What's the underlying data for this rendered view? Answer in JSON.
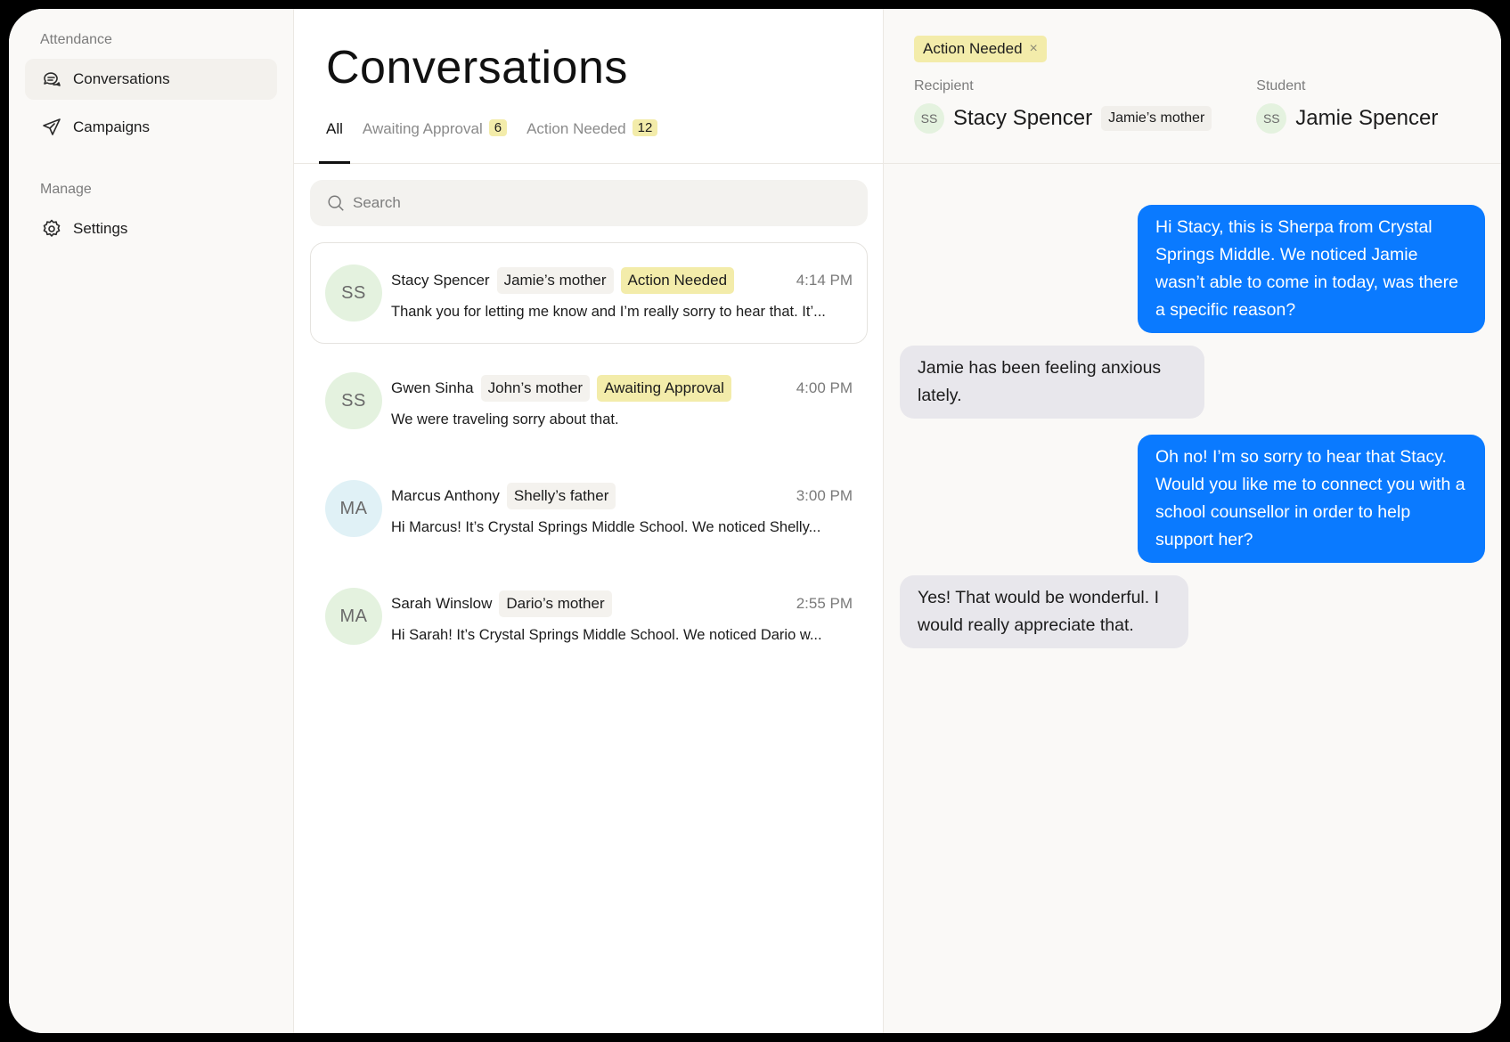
{
  "sidebar": {
    "section_attendance": "Attendance",
    "section_manage": "Manage",
    "items": [
      {
        "label": "Conversations",
        "icon": "chat-bubbles-icon",
        "active": true
      },
      {
        "label": "Campaigns",
        "icon": "send-icon",
        "active": false
      },
      {
        "label": "Settings",
        "icon": "gear-icon",
        "active": false
      }
    ]
  },
  "list": {
    "title": "Conversations",
    "tabs": [
      {
        "label": "All",
        "count": null
      },
      {
        "label": "Awaiting Approval",
        "count": "6"
      },
      {
        "label": "Action Needed",
        "count": "12"
      }
    ],
    "search_placeholder": "Search",
    "conversations": [
      {
        "initials": "SS",
        "name": "Stacy Spencer",
        "relation": "Jamie’s mother",
        "status": "Action Needed",
        "time": "4:14 PM",
        "preview": "Thank you for letting me know and I’m really sorry to hear that. It’...",
        "avatar_color": "#e4f2df"
      },
      {
        "initials": "SS",
        "name": "Gwen Sinha",
        "relation": "John’s mother",
        "status": "Awaiting Approval",
        "time": "4:00 PM",
        "preview": "We were traveling sorry about that.",
        "avatar_color": "#e4f2df"
      },
      {
        "initials": "MA",
        "name": "Marcus Anthony",
        "relation": "Shelly’s father",
        "status": "",
        "time": "3:00 PM",
        "preview": "Hi Marcus! It’s Crystal Springs Middle School. We noticed Shelly...",
        "avatar_color": "#e0f1f6"
      },
      {
        "initials": "MA",
        "name": "Sarah Winslow",
        "relation": "Dario’s mother",
        "status": "",
        "time": "2:55 PM",
        "preview": "Hi Sarah! It’s Crystal Springs Middle School. We noticed Dario w...",
        "avatar_color": "#e4f2df"
      }
    ]
  },
  "detail": {
    "tag": "Action Needed",
    "tag_close": "×",
    "recipient_label": "Recipient",
    "recipient_initials": "SS",
    "recipient_name": "Stacy Spencer",
    "recipient_relation": "Jamie’s mother",
    "student_label": "Student",
    "student_initials": "SS",
    "student_name": "Jamie Spencer",
    "messages": [
      {
        "direction": "out",
        "text": "Hi Stacy, this is Sherpa from Crystal Springs Middle. We noticed Jamie wasn’t able to come in today, was there a specific reason?"
      },
      {
        "direction": "in",
        "text": "Jamie has been feeling anxious lately."
      },
      {
        "direction": "out",
        "text": "Oh no! I’m so sorry to hear that Stacy. Would you like me to connect you with a school counsellor in order to help support her?"
      },
      {
        "direction": "in",
        "text": "Yes! That would be wonderful. I would really appreciate that."
      }
    ]
  },
  "colors": {
    "accent_blue": "#0a7aff",
    "status_yellow": "#f3ecaa",
    "incoming_bubble": "#e8e7ec"
  }
}
